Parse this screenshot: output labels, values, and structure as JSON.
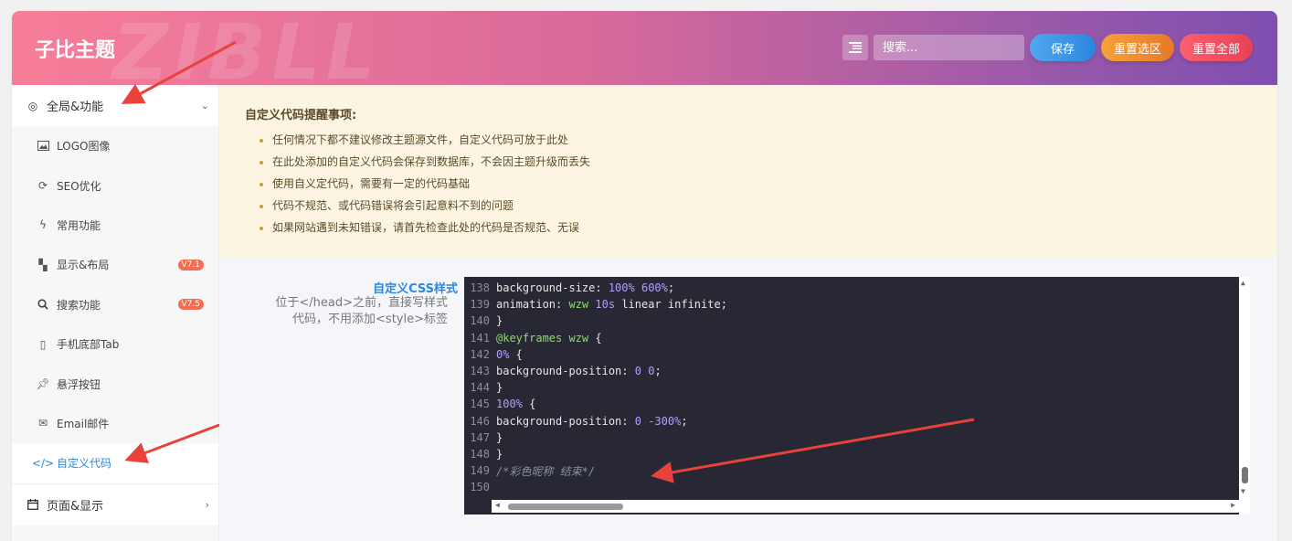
{
  "header": {
    "brand": "子比主题",
    "watermark": "ZIBLL",
    "search_placeholder": "搜索...",
    "save_label": "保存",
    "reset_section_label": "重置选区",
    "reset_all_label": "重置全部"
  },
  "sidebar": {
    "group_global": "全局&功能",
    "items": [
      {
        "label": "LOGO图像",
        "icon": "image-icon"
      },
      {
        "label": "SEO优化",
        "icon": "refresh-icon"
      },
      {
        "label": "常用功能",
        "icon": "bolt-icon"
      },
      {
        "label": "显示&布局",
        "icon": "layout-icon",
        "badge": "V7.1"
      },
      {
        "label": "搜索功能",
        "icon": "search-icon",
        "badge": "V7.5"
      },
      {
        "label": "手机底部Tab",
        "icon": "mobile-icon"
      },
      {
        "label": "悬浮按钮",
        "icon": "pin-icon"
      },
      {
        "label": "Email邮件",
        "icon": "mail-icon"
      },
      {
        "label": "自定义代码",
        "icon": "code-icon"
      }
    ],
    "group_page": "页面&显示"
  },
  "notice": {
    "title": "自定义代码提醒事项:",
    "items": [
      "任何情况下都不建议修改主题源文件，自定义代码可放于此处",
      "在此处添加的自定义代码会保存到数据库，不会因主题升级而丢失",
      "使用自义定代码，需要有一定的代码基础",
      "代码不规范、或代码错误将会引起意料不到的问题",
      "如果网站遇到未知错误，请首先检查此处的代码是否规范、无误"
    ]
  },
  "field": {
    "title": "自定义CSS样式",
    "desc": "位于</head>之前，直接写样式代码，不用添加<style>标签"
  },
  "editor": {
    "lines": [
      {
        "n": "138",
        "code": "background-size: 100% 600%;"
      },
      {
        "n": "139",
        "code": "animation: wzw 10s linear infinite;"
      },
      {
        "n": "140",
        "code": "}"
      },
      {
        "n": "141",
        "code": "@keyframes wzw {"
      },
      {
        "n": "142",
        "code": "0% {"
      },
      {
        "n": "143",
        "code": "background-position: 0 0;"
      },
      {
        "n": "144",
        "code": "}"
      },
      {
        "n": "145",
        "code": "100% {"
      },
      {
        "n": "146",
        "code": "background-position: 0 -300%;"
      },
      {
        "n": "147",
        "code": "}"
      },
      {
        "n": "148",
        "code": "}"
      },
      {
        "n": "149",
        "code": "/*彩色昵称 结束*/"
      },
      {
        "n": "150",
        "code": ""
      }
    ]
  },
  "colors": {
    "accent": "#2b88e0",
    "annotation_arrow": "#e8423b"
  }
}
